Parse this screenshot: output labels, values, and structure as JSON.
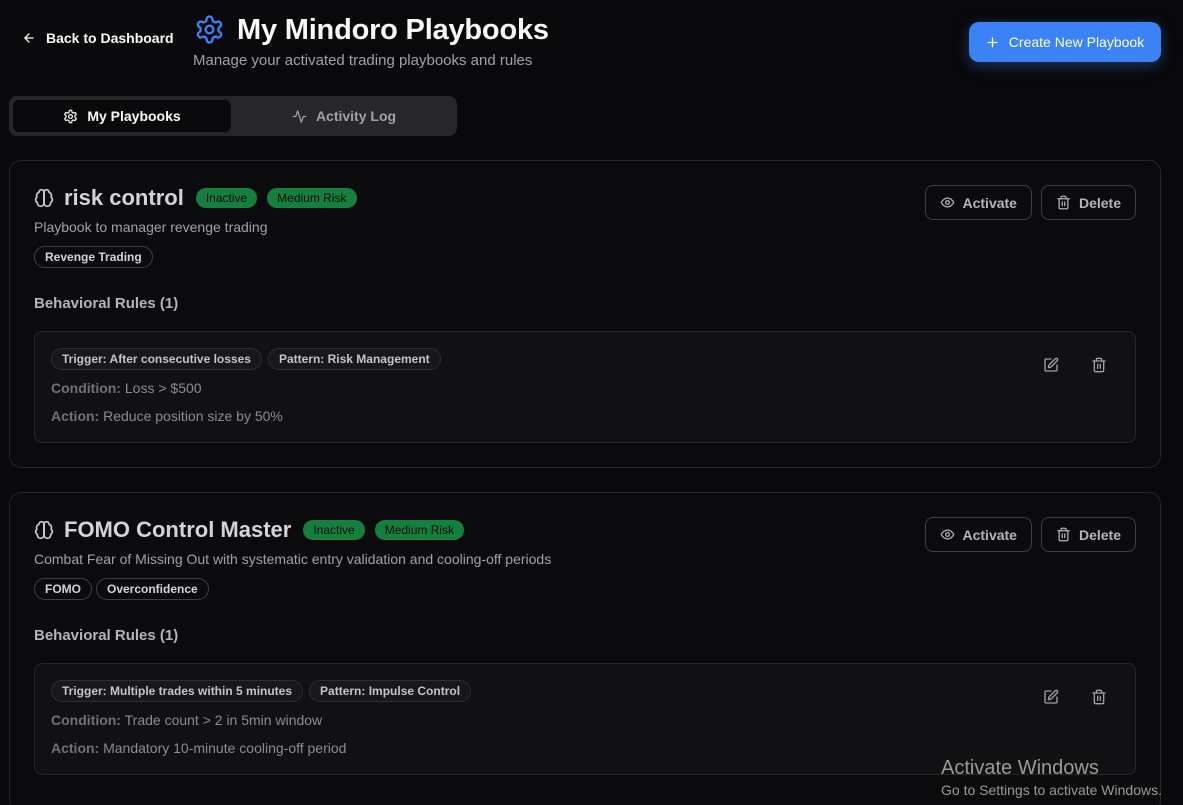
{
  "header": {
    "back_label": "Back to Dashboard",
    "title": "My Mindoro Playbooks",
    "subtitle": "Manage your activated trading playbooks and rules",
    "create_label": "Create New Playbook",
    "accent_color": "#3b82f6"
  },
  "tabs": [
    {
      "label": "My Playbooks",
      "icon": "gear-icon",
      "active": true
    },
    {
      "label": "Activity Log",
      "icon": "activity-icon",
      "active": false
    }
  ],
  "playbooks": [
    {
      "title": "risk control",
      "status": "Inactive",
      "risk": "Medium Risk",
      "description": "Playbook to manager revenge trading",
      "tags": [
        "Revenge Trading"
      ],
      "rules_heading": "Behavioral Rules (1)",
      "activate_label": "Activate",
      "delete_label": "Delete",
      "rule": {
        "trigger": "Trigger: After consecutive losses",
        "pattern": "Pattern: Risk Management",
        "condition_label": "Condition:",
        "condition": "Loss > $500",
        "action_label": "Action:",
        "action": "Reduce position size by 50%"
      }
    },
    {
      "title": "FOMO Control Master",
      "status": "Inactive",
      "risk": "Medium Risk",
      "description": "Combat Fear of Missing Out with systematic entry validation and cooling-off periods",
      "tags": [
        "FOMO",
        "Overconfidence"
      ],
      "rules_heading": "Behavioral Rules (1)",
      "activate_label": "Activate",
      "delete_label": "Delete",
      "rule": {
        "trigger": "Trigger: Multiple trades within 5 minutes",
        "pattern": "Pattern: Impulse Control",
        "condition_label": "Condition:",
        "condition": "Trade count > 2 in 5min window",
        "action_label": "Action:",
        "action": "Mandatory 10-minute cooling-off period"
      }
    }
  ],
  "status_color": "#15803d",
  "watermark": {
    "title": "Activate Windows",
    "subtitle": "Go to Settings to activate Windows."
  }
}
